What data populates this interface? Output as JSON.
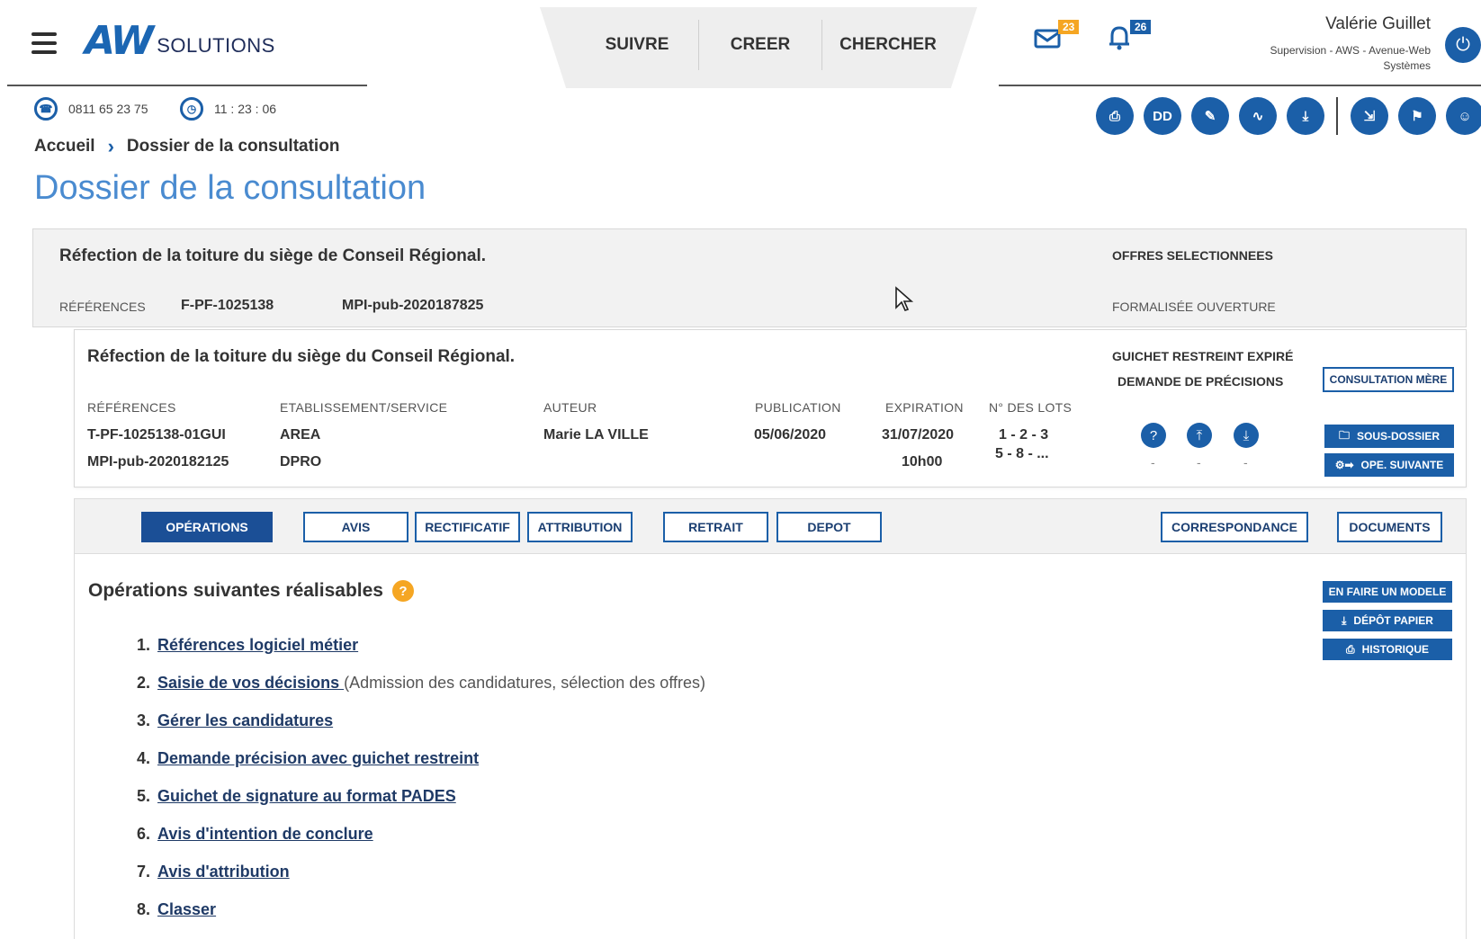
{
  "header": {
    "logo_aw": "AW",
    "logo_solutions": "SOLUTIONS",
    "nav": [
      "SUIVRE",
      "CREER",
      "CHERCHER"
    ],
    "mail_count": "23",
    "notif_count": "26",
    "user_name": "Valérie Guillet",
    "user_role": "Supervision - AWS - Avenue-Web Systèmes",
    "phone": "0811 65 23 75",
    "time": "11 : 23 : 06"
  },
  "breadcrumb": {
    "home": "Accueil",
    "current": "Dossier de la consultation"
  },
  "page_title": "Dossier de la consultation",
  "toolbar": {
    "dd_label": "DD"
  },
  "card1": {
    "title": "Réfection de la toiture du siège de Conseil Régional.",
    "ref_label": "RÉFÉRENCES",
    "ref1": "F-PF-1025138",
    "ref2": "MPI-pub-2020187825",
    "status1": "OFFRES SELECTIONNEES",
    "status2": "FORMALISÉE OUVERTURE"
  },
  "card2": {
    "title": "Réfection de la toiture du siège du Conseil Régional.",
    "status1": "GUICHET RESTREINT EXPIRÉ",
    "status2": "DEMANDE DE PRÉCISIONS",
    "headers": {
      "refs": "RÉFÉRENCES",
      "service": "ETABLISSEMENT/SERVICE",
      "author": "AUTEUR",
      "publication": "PUBLICATION",
      "expiration": "EXPIRATION",
      "lots": "N° DES LOTS"
    },
    "ref1": "T-PF-1025138-01GUI",
    "ref2": "MPI-pub-2020182125",
    "service1": "AREA",
    "service2": "DPRO",
    "author": "Marie LA VILLE",
    "publication": "05/06/2020",
    "expiration_date": "31/07/2020",
    "expiration_time": "10h00",
    "lots1": "1 - 2 - 3",
    "lots2": "5 - 8 - ...",
    "dash1": "-",
    "dash2": "-",
    "dash3": "-",
    "btn_mere": "CONSULTATION MÈRE",
    "btn_sous_dossier": "SOUS-DOSSIER",
    "btn_ope_suivante": "OPE. SUIVANTE"
  },
  "tabs": {
    "operations": "OPÉRATIONS",
    "avis": "AVIS",
    "rectificatif": "RECTIFICATIF",
    "attribution": "ATTRIBUTION",
    "retrait": "RETRAIT",
    "depot": "DEPOT",
    "correspondance": "CORRESPONDANCE",
    "documents": "DOCUMENTS"
  },
  "operations": {
    "title": "Opérations suivantes réalisables",
    "help": "?",
    "items": [
      {
        "num": "1.",
        "label": "Références logiciel métier",
        "note": ""
      },
      {
        "num": "2.",
        "label": "Saisie de vos décisions ",
        "note": "(Admission des candidatures, sélection des offres)"
      },
      {
        "num": "3.",
        "label": "Gérer les candidatures",
        "note": ""
      },
      {
        "num": "4.",
        "label": "Demande précision avec guichet restreint",
        "note": ""
      },
      {
        "num": "5.",
        "label": "Guichet de signature au format PADES",
        "note": ""
      },
      {
        "num": "6.",
        "label": "Avis d'intention de conclure",
        "note": ""
      },
      {
        "num": "7.",
        "label": "Avis d'attribution",
        "note": ""
      },
      {
        "num": "8.",
        "label": "Classer",
        "note": ""
      }
    ],
    "btn_modele": "EN FAIRE UN MODELE",
    "btn_depot_papier": "DÉPÔT PAPIER",
    "btn_historique": "HISTORIQUE"
  }
}
